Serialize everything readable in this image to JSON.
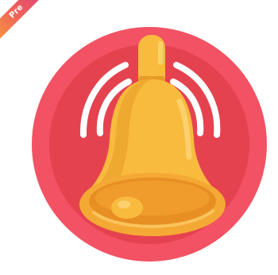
{
  "badge": {
    "text": "Pre",
    "gradient_colors": [
      "#f7a533",
      "#ef5b61",
      "#d63a7a"
    ]
  },
  "icon": {
    "name": "ringing-bell-icon",
    "colors": {
      "outer_circle": "#f25263",
      "inner_circle": "#e5424f",
      "waves": "#ffffff",
      "bell_main": "#f8bb3d",
      "bell_highlight": "#fcd06d",
      "bell_shadow": "#e69a28",
      "bell_rim": "#f5a935",
      "bell_rim_inner": "#e88f24"
    }
  }
}
